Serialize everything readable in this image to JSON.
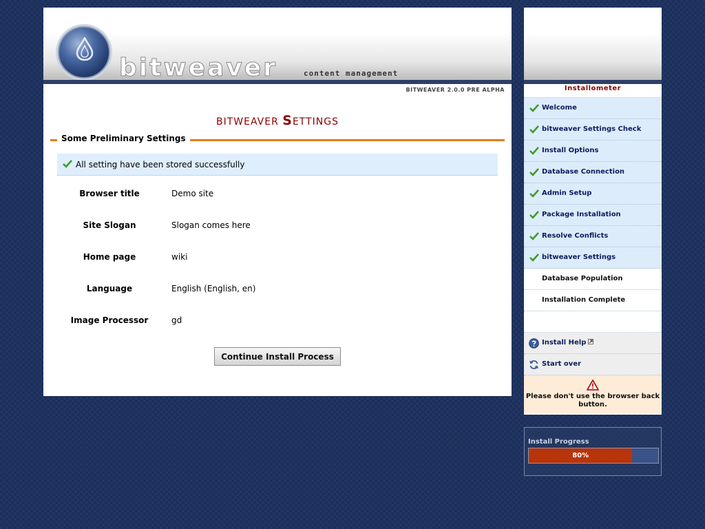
{
  "header": {
    "logo_word": "bitweaver",
    "logo_sub": "content management",
    "version": "BITWEAVER 2.0.0 PRE ALPHA"
  },
  "main": {
    "title_lead": "BITWEAVER ",
    "title_cap": "S",
    "title_rest": "ETTINGS",
    "section_title": "Some Preliminary Settings",
    "success_message": "All setting have been stored successfully",
    "settings": [
      {
        "label": "Browser title",
        "value": "Demo site"
      },
      {
        "label": "Site Slogan",
        "value": "Slogan comes here"
      },
      {
        "label": "Home page",
        "value": "wiki"
      },
      {
        "label": "Language",
        "value": "English (English, en)"
      },
      {
        "label": "Image Processor",
        "value": "gd"
      }
    ],
    "continue_label": "Continue Install Process"
  },
  "sidebar": {
    "title": "Installometer",
    "steps": [
      {
        "label": "Welcome",
        "done": true
      },
      {
        "label": "bitweaver Settings Check",
        "done": true
      },
      {
        "label": "Install Options",
        "done": true
      },
      {
        "label": "Database Connection",
        "done": true
      },
      {
        "label": "Admin Setup",
        "done": true
      },
      {
        "label": "Package Installation",
        "done": true
      },
      {
        "label": "Resolve Conflicts",
        "done": true
      },
      {
        "label": "bitweaver Settings",
        "done": true
      },
      {
        "label": "Database Population",
        "done": false
      },
      {
        "label": "Installation Complete",
        "done": false
      }
    ],
    "install_help": "Install Help",
    "start_over": "Start over",
    "warning": "Please don't use the browser back button."
  },
  "progress": {
    "label": "Install Progress",
    "text": "80%",
    "fraction": 0.8
  },
  "colors": {
    "accent_red": "#8b0000",
    "orange_rule": "#e87a1e",
    "progress_fill": "#b8340b",
    "done_bg": "#dcecfb"
  },
  "icons": {
    "check": "check-icon",
    "help": "help-icon",
    "restart": "restart-icon",
    "warning": "warning-icon",
    "external": "external-link-icon"
  }
}
